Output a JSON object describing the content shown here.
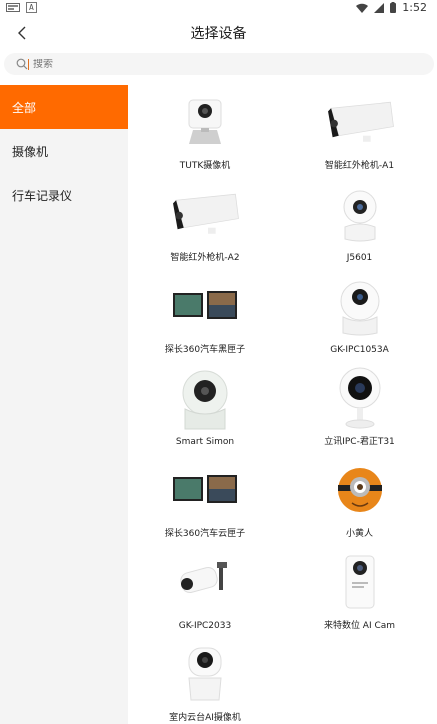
{
  "status_bar": {
    "left_icons": [
      "notification-icon",
      "app-a-icon"
    ],
    "app_icon_letter": "A",
    "time": "1:52"
  },
  "header": {
    "title": "选择设备"
  },
  "search": {
    "placeholder": "搜索"
  },
  "sidebar": {
    "items": [
      {
        "label": "全部",
        "active": true
      },
      {
        "label": "摄像机",
        "active": false
      },
      {
        "label": "行车记录仪",
        "active": false
      }
    ]
  },
  "colors": {
    "accent": "#ff6a00",
    "sidebar_bg": "#f4f4f4"
  },
  "devices": [
    {
      "label": "TUTK摄像机",
      "icon": "cube-camera-icon"
    },
    {
      "label": "智能红外枪机-A1",
      "icon": "bullet-camera-icon"
    },
    {
      "label": "智能红外枪机-A2",
      "icon": "bullet-camera-icon"
    },
    {
      "label": "J5601",
      "icon": "ptz-camera-icon"
    },
    {
      "label": "探长360汽车黑匣子",
      "icon": "dashcam-icon"
    },
    {
      "label": "GK-IPC1053A",
      "icon": "dome-camera-icon"
    },
    {
      "label": "Smart Simon",
      "icon": "dome-camera-icon"
    },
    {
      "label": "立讯IPC-君正T31",
      "icon": "round-camera-icon"
    },
    {
      "label": "探长360汽车云匣子",
      "icon": "dashcam-icon"
    },
    {
      "label": "小黄人",
      "icon": "minion-camera-icon"
    },
    {
      "label": "GK-IPC2033",
      "icon": "outdoor-camera-icon"
    },
    {
      "label": "来特数位 AI Cam",
      "icon": "box-camera-icon"
    },
    {
      "label": "室内云台AI摄像机",
      "icon": "ptz-camera-icon"
    }
  ]
}
